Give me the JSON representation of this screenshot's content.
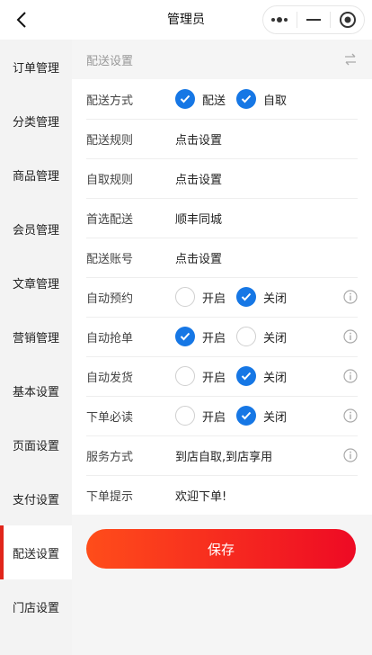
{
  "header": {
    "title": "管理员"
  },
  "sidebar": {
    "items": [
      {
        "label": "订单管理"
      },
      {
        "label": "分类管理"
      },
      {
        "label": "商品管理"
      },
      {
        "label": "会员管理"
      },
      {
        "label": "文章管理"
      },
      {
        "label": "营销管理"
      },
      {
        "label": "基本设置"
      },
      {
        "label": "页面设置"
      },
      {
        "label": "支付设置"
      },
      {
        "label": "配送设置",
        "active": true
      },
      {
        "label": "门店设置"
      }
    ]
  },
  "section": {
    "title": "配送设置"
  },
  "rows": {
    "delivery_method": {
      "label": "配送方式",
      "opt1": "配送",
      "opt2": "自取",
      "opt1_checked": true,
      "opt2_checked": true
    },
    "delivery_rules": {
      "label": "配送规则",
      "value": "点击设置"
    },
    "pickup_rules": {
      "label": "自取规则",
      "value": "点击设置"
    },
    "preferred_delivery": {
      "label": "首选配送",
      "value": "顺丰同城"
    },
    "delivery_account": {
      "label": "配送账号",
      "value": "点击设置"
    },
    "auto_booking": {
      "label": "自动预约",
      "on": "开启",
      "off": "关闭",
      "selected": "off"
    },
    "auto_grab": {
      "label": "自动抢单",
      "on": "开启",
      "off": "关闭",
      "selected": "on"
    },
    "auto_ship": {
      "label": "自动发货",
      "on": "开启",
      "off": "关闭",
      "selected": "off"
    },
    "must_read": {
      "label": "下单必读",
      "on": "开启",
      "off": "关闭",
      "selected": "off"
    },
    "service_mode": {
      "label": "服务方式",
      "value": "到店自取,到店享用"
    },
    "order_tip": {
      "label": "下单提示",
      "value": "欢迎下单!"
    }
  },
  "save_button": {
    "label": "保存"
  },
  "colors": {
    "accent_blue": "#1677e5",
    "accent_red": "#e1251b",
    "button_start": "#ff4d1a",
    "button_end": "#ee0a24"
  }
}
